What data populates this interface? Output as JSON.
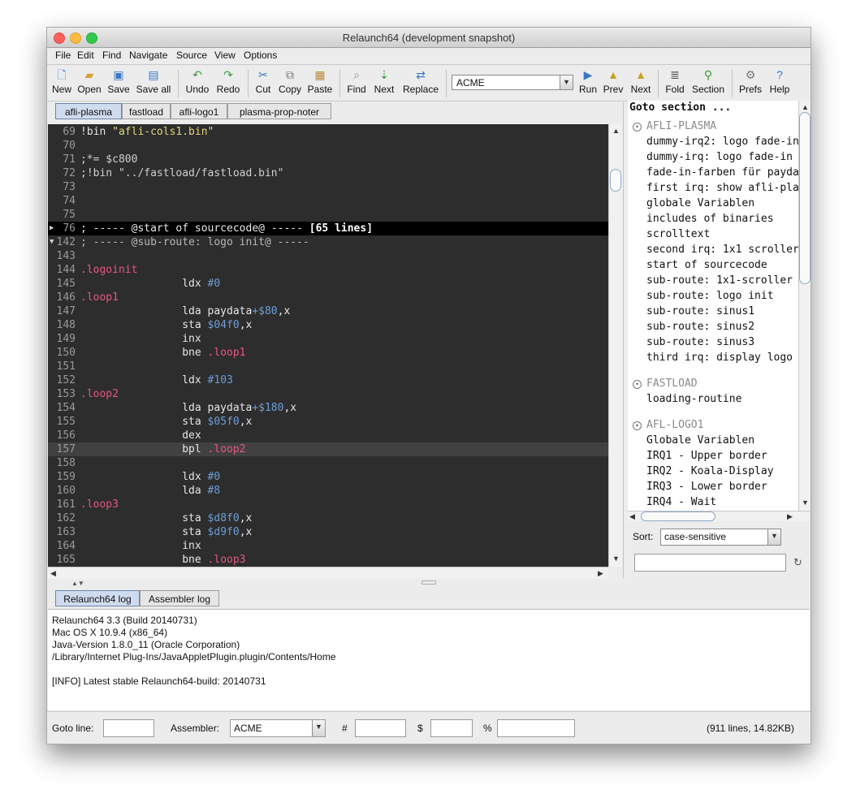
{
  "window": {
    "title": "Relaunch64 (development snapshot)"
  },
  "menu": [
    "File",
    "Edit",
    "Find",
    "Navigate",
    "Source",
    "View",
    "Options"
  ],
  "toolbar": {
    "new": "New",
    "open": "Open",
    "save": "Save",
    "save_all": "Save all",
    "undo": "Undo",
    "redo": "Redo",
    "cut": "Cut",
    "copy": "Copy",
    "paste": "Paste",
    "find": "Find",
    "next": "Next",
    "replace": "Replace",
    "assembler": "ACME",
    "run": "Run",
    "prev": "Prev",
    "next2": "Next",
    "fold": "Fold",
    "section": "Section",
    "prefs": "Prefs",
    "help": "Help"
  },
  "tabs": [
    "afli-plasma",
    "fastload",
    "afli-logo1",
    "plasma-prop-noter"
  ],
  "editor": {
    "lines": [
      {
        "n": "69",
        "parts": [
          {
            "t": "!bin ",
            "c": "c-wht"
          },
          {
            "t": "\"afli-cols1.bin\"",
            "c": "c-str"
          }
        ]
      },
      {
        "n": "70",
        "parts": []
      },
      {
        "n": "71",
        "parts": [
          {
            "t": ";*= $c800",
            "c": "c-cmt"
          }
        ]
      },
      {
        "n": "72",
        "parts": [
          {
            "t": ";!bin \"../fastload/fastload.bin\"",
            "c": "c-cmt"
          }
        ]
      },
      {
        "n": "73",
        "parts": []
      },
      {
        "n": "74",
        "parts": []
      },
      {
        "n": "75",
        "parts": []
      },
      {
        "n": "76",
        "fold": "▶",
        "hl": "fold",
        "parts": [
          {
            "t": "; ----- @start of sourcecode@ ----- ",
            "c": "c-wht"
          },
          {
            "t": "[65 lines]",
            "c": "c-bold"
          }
        ]
      },
      {
        "n": "142",
        "fold": "▼",
        "parts": [
          {
            "t": "; ----- @sub-route: logo init@ -----",
            "c": "c-grey"
          }
        ]
      },
      {
        "n": "143",
        "parts": []
      },
      {
        "n": "144",
        "parts": [
          {
            "t": ".logoinit",
            "c": "c-lbl"
          }
        ]
      },
      {
        "n": "145",
        "parts": [
          {
            "t": "                ldx ",
            "c": "c-wht"
          },
          {
            "t": "#0",
            "c": "c-hex"
          }
        ]
      },
      {
        "n": "146",
        "parts": [
          {
            "t": ".loop1",
            "c": "c-lbl"
          }
        ]
      },
      {
        "n": "147",
        "parts": [
          {
            "t": "                lda paydata",
            "c": "c-wht"
          },
          {
            "t": "+$80",
            "c": "c-hex"
          },
          {
            "t": ",x",
            "c": "c-wht"
          }
        ]
      },
      {
        "n": "148",
        "parts": [
          {
            "t": "                sta ",
            "c": "c-wht"
          },
          {
            "t": "$04f0",
            "c": "c-hex"
          },
          {
            "t": ",x",
            "c": "c-wht"
          }
        ]
      },
      {
        "n": "149",
        "parts": [
          {
            "t": "                inx",
            "c": "c-wht"
          }
        ]
      },
      {
        "n": "150",
        "parts": [
          {
            "t": "                bne ",
            "c": "c-wht"
          },
          {
            "t": ".loop1",
            "c": "c-lbl"
          }
        ]
      },
      {
        "n": "151",
        "parts": []
      },
      {
        "n": "152",
        "parts": [
          {
            "t": "                ldx ",
            "c": "c-wht"
          },
          {
            "t": "#103",
            "c": "c-hex"
          }
        ]
      },
      {
        "n": "153",
        "parts": [
          {
            "t": ".loop2",
            "c": "c-lbl"
          }
        ]
      },
      {
        "n": "154",
        "parts": [
          {
            "t": "                lda paydata",
            "c": "c-wht"
          },
          {
            "t": "+$180",
            "c": "c-hex"
          },
          {
            "t": ",x",
            "c": "c-wht"
          }
        ]
      },
      {
        "n": "155",
        "parts": [
          {
            "t": "                sta ",
            "c": "c-wht"
          },
          {
            "t": "$05f0",
            "c": "c-hex"
          },
          {
            "t": ",x",
            "c": "c-wht"
          }
        ]
      },
      {
        "n": "156",
        "parts": [
          {
            "t": "                dex",
            "c": "c-wht"
          }
        ]
      },
      {
        "n": "157",
        "hl": "curr",
        "parts": [
          {
            "t": "                bpl ",
            "c": "c-wht"
          },
          {
            "t": ".loop2",
            "c": "c-lbl"
          }
        ]
      },
      {
        "n": "158",
        "parts": []
      },
      {
        "n": "159",
        "parts": [
          {
            "t": "                ldx ",
            "c": "c-wht"
          },
          {
            "t": "#0",
            "c": "c-hex"
          }
        ]
      },
      {
        "n": "160",
        "parts": [
          {
            "t": "                lda ",
            "c": "c-wht"
          },
          {
            "t": "#8",
            "c": "c-hex"
          }
        ]
      },
      {
        "n": "161",
        "parts": [
          {
            "t": ".loop3",
            "c": "c-lbl"
          }
        ]
      },
      {
        "n": "162",
        "parts": [
          {
            "t": "                sta ",
            "c": "c-wht"
          },
          {
            "t": "$d8f0",
            "c": "c-hex"
          },
          {
            "t": ",x",
            "c": "c-wht"
          }
        ]
      },
      {
        "n": "163",
        "parts": [
          {
            "t": "                sta ",
            "c": "c-wht"
          },
          {
            "t": "$d9f0",
            "c": "c-hex"
          },
          {
            "t": ",x",
            "c": "c-wht"
          }
        ]
      },
      {
        "n": "164",
        "parts": [
          {
            "t": "                inx",
            "c": "c-wht"
          }
        ]
      },
      {
        "n": "165",
        "parts": [
          {
            "t": "                bne ",
            "c": "c-wht"
          },
          {
            "t": ".loop3",
            "c": "c-lbl"
          }
        ]
      }
    ]
  },
  "goto": {
    "title": "Goto section ...",
    "groups": [
      {
        "name": "AFLI-PLASMA",
        "items": [
          "dummy-irq2: logo fade-in",
          "dummy-irq: logo fade-in",
          "fade-in-farben für payda",
          "first irq: show afli-pla",
          "globale Variablen",
          "includes of binaries",
          "scrolltext",
          "second irq: 1x1 scroller",
          "start of sourcecode",
          "sub-route: 1x1-scroller",
          "sub-route: logo init",
          "sub-route: sinus1",
          "sub-route: sinus2",
          "sub-route: sinus3",
          "third irq: display logo"
        ]
      },
      {
        "name": "FASTLOAD",
        "items": [
          "loading-routine"
        ]
      },
      {
        "name": "AFL-LOGO1",
        "items": [
          "Globale Variablen",
          "IRQ1 - Upper border",
          "IRQ2 - Koala-Display",
          "IRQ3 - Lower border",
          "IRQ4 - Wait"
        ]
      }
    ],
    "sort_label": "Sort:",
    "sort_value": "case-sensitive"
  },
  "log": {
    "tabs": [
      "Relaunch64 log",
      "Assembler log"
    ],
    "lines": [
      "Relaunch64 3.3 (Build 20140731)",
      "Mac OS X 10.9.4 (x86_64)",
      "Java-Version 1.8.0_11 (Oracle Corporation)",
      "/Library/Internet Plug-Ins/JavaAppletPlugin.plugin/Contents/Home",
      "",
      "[INFO] Latest stable Relaunch64-build: 20140731"
    ]
  },
  "status": {
    "goto_label": "Goto line:",
    "assembler_label": "Assembler:",
    "assembler_value": "ACME",
    "hash": "#",
    "dollar": "$",
    "percent": "%",
    "info": "(911 lines, 14.82KB)"
  }
}
